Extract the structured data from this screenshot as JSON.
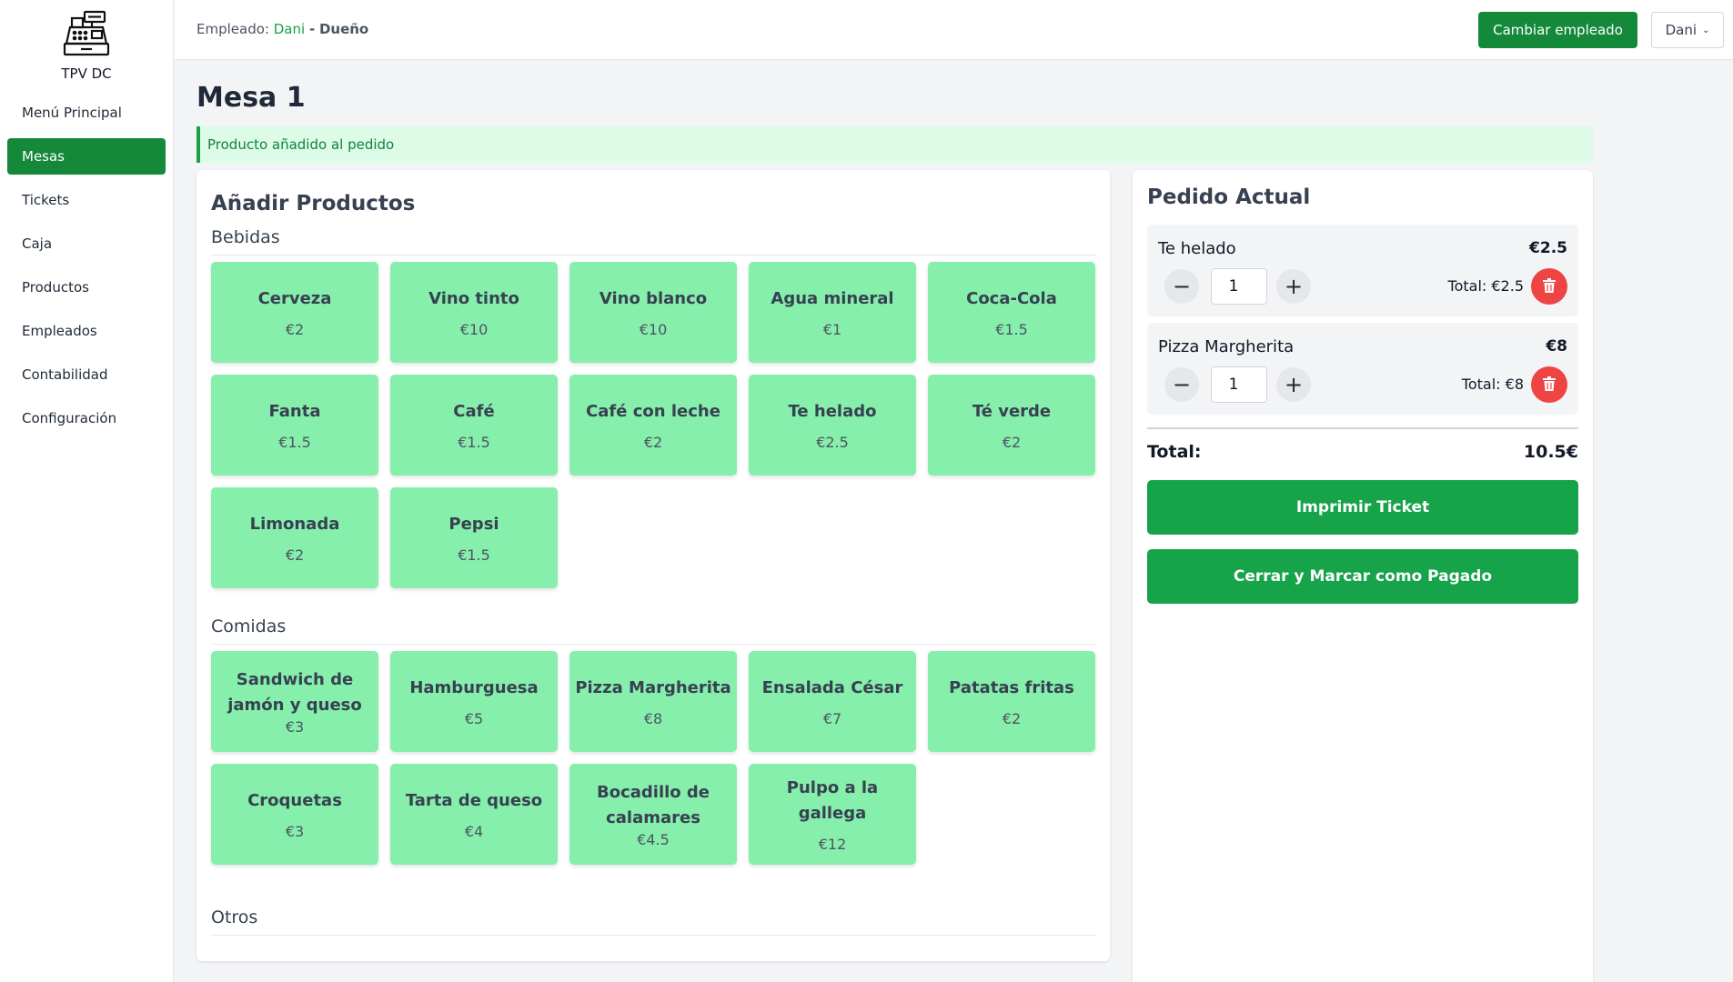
{
  "app": {
    "name": "TPV DC",
    "logo_icon": "cash-register-icon"
  },
  "sidebar": {
    "items": [
      {
        "label": "Menú Principal",
        "active": false
      },
      {
        "label": "Mesas",
        "active": true
      },
      {
        "label": "Tickets",
        "active": false
      },
      {
        "label": "Caja",
        "active": false
      },
      {
        "label": "Productos",
        "active": false
      },
      {
        "label": "Empleados",
        "active": false
      },
      {
        "label": "Contabilidad",
        "active": false
      },
      {
        "label": "Configuración",
        "active": false
      }
    ]
  },
  "header": {
    "employee_prefix": "Empleado:",
    "employee_name": "Dani",
    "separator": "-",
    "employee_role": "Dueño",
    "change_button": "Cambiar empleado",
    "user_menu": "Dani"
  },
  "page": {
    "title": "Mesa 1",
    "alert": "Producto añadido al pedido"
  },
  "products_panel": {
    "title": "Añadir Productos",
    "sections": [
      {
        "name": "Bebidas",
        "items": [
          {
            "name": "Cerveza",
            "price": "€2"
          },
          {
            "name": "Vino tinto",
            "price": "€10"
          },
          {
            "name": "Vino blanco",
            "price": "€10"
          },
          {
            "name": "Agua mineral",
            "price": "€1"
          },
          {
            "name": "Coca-Cola",
            "price": "€1.5"
          },
          {
            "name": "Fanta",
            "price": "€1.5"
          },
          {
            "name": "Café",
            "price": "€1.5"
          },
          {
            "name": "Café con leche",
            "price": "€2"
          },
          {
            "name": "Te helado",
            "price": "€2.5"
          },
          {
            "name": "Té verde",
            "price": "€2"
          },
          {
            "name": "Limonada",
            "price": "€2"
          },
          {
            "name": "Pepsi",
            "price": "€1.5"
          }
        ]
      },
      {
        "name": "Comidas",
        "items": [
          {
            "name": "Sandwich de jamón y queso",
            "price": "€3"
          },
          {
            "name": "Hamburguesa",
            "price": "€5"
          },
          {
            "name": "Pizza Margherita",
            "price": "€8"
          },
          {
            "name": "Ensalada César",
            "price": "€7"
          },
          {
            "name": "Patatas fritas",
            "price": "€2"
          },
          {
            "name": "Croquetas",
            "price": "€3"
          },
          {
            "name": "Tarta de queso",
            "price": "€4"
          },
          {
            "name": "Bocadillo de calamares",
            "price": "€4.5"
          },
          {
            "name": "Pulpo a la gallega",
            "price": "€12"
          }
        ]
      },
      {
        "name": "Otros",
        "items": []
      }
    ]
  },
  "order": {
    "title": "Pedido Actual",
    "items": [
      {
        "name": "Te helado",
        "price": "€2.5",
        "quantity": "1",
        "total": "Total: €2.5"
      },
      {
        "name": "Pizza Margherita",
        "price": "€8",
        "quantity": "1",
        "total": "Total: €8"
      }
    ],
    "total_label": "Total:",
    "total_value": "10.5€",
    "print_button": "Imprimir Ticket",
    "close_button": "Cerrar y Marcar como Pagado"
  },
  "colors": {
    "primary": "#15893a",
    "product_tile": "#86efac",
    "alert_bg": "#dcfce7",
    "danger": "#ef4444"
  }
}
